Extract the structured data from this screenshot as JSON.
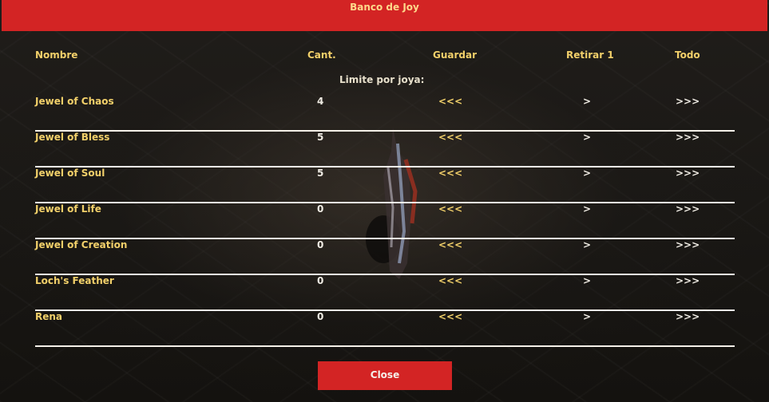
{
  "window": {
    "title": "Banco de Joy"
  },
  "columns": {
    "name": "Nombre",
    "qty": "Cant.",
    "store": "Guardar",
    "withdraw_one": "Retirar 1",
    "withdraw_all": "Todo"
  },
  "limit_label": "Limite por joya:",
  "rows": [
    {
      "name": "Jewel of Chaos",
      "qty": "4",
      "store": "<<<",
      "withdraw_one": ">",
      "withdraw_all": ">>>"
    },
    {
      "name": "Jewel of Bless",
      "qty": "5",
      "store": "<<<",
      "withdraw_one": ">",
      "withdraw_all": ">>>"
    },
    {
      "name": "Jewel of Soul",
      "qty": "5",
      "store": "<<<",
      "withdraw_one": ">",
      "withdraw_all": ">>>"
    },
    {
      "name": "Jewel of Life",
      "qty": "0",
      "store": "<<<",
      "withdraw_one": ">",
      "withdraw_all": ">>>"
    },
    {
      "name": "Jewel of Creation",
      "qty": "0",
      "store": "<<<",
      "withdraw_one": ">",
      "withdraw_all": ">>>"
    },
    {
      "name": "Loch's Feather",
      "qty": "0",
      "store": "<<<",
      "withdraw_one": ">",
      "withdraw_all": ">>>"
    },
    {
      "name": "Rena",
      "qty": "0",
      "store": "<<<",
      "withdraw_one": ">",
      "withdraw_all": ">>>"
    }
  ],
  "close_label": "Close",
  "colors": {
    "header_bg": "#d32424",
    "label_gold": "#f2d06a",
    "divider": "#f4f0e8"
  }
}
